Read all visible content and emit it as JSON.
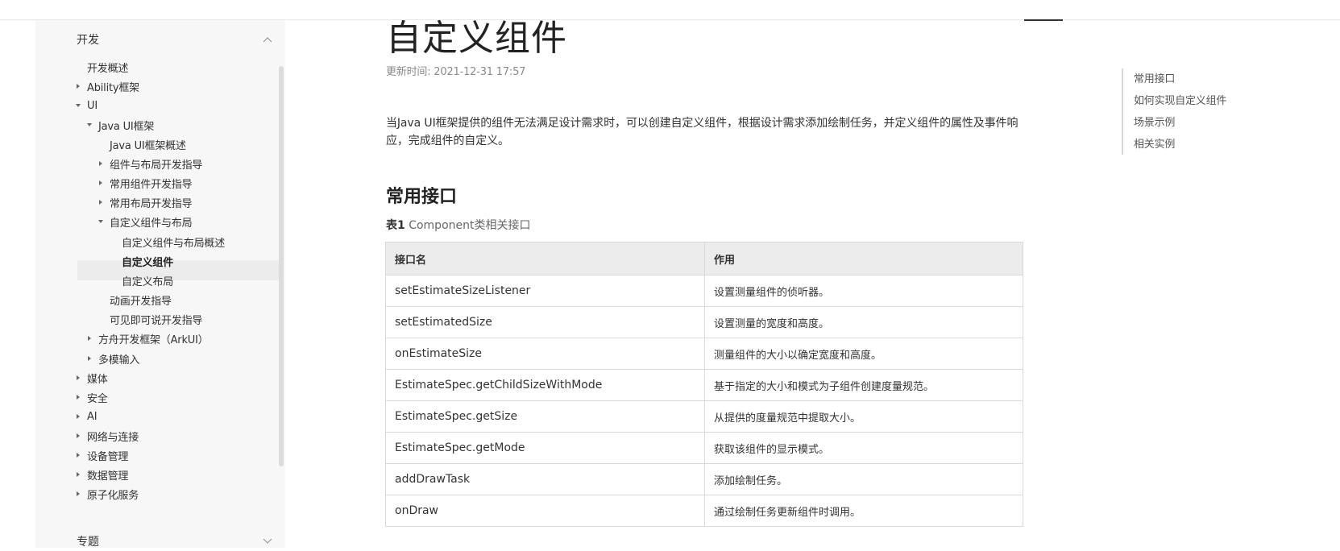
{
  "sidebar": {
    "section_dev": "开发",
    "section_topics": "专题",
    "items": [
      {
        "label": "开发概述"
      },
      {
        "label": "Ability框架"
      },
      {
        "label": "UI"
      },
      {
        "label": "Java UI框架"
      },
      {
        "label": "Java UI框架概述"
      },
      {
        "label": "组件与布局开发指导"
      },
      {
        "label": "常用组件开发指导"
      },
      {
        "label": "常用布局开发指导"
      },
      {
        "label": "自定义组件与布局"
      },
      {
        "label": "自定义组件与布局概述"
      },
      {
        "label": "自定义组件"
      },
      {
        "label": "自定义布局"
      },
      {
        "label": "动画开发指导"
      },
      {
        "label": "可见即可说开发指导"
      },
      {
        "label": "方舟开发框架（ArkUI）"
      },
      {
        "label": "多模输入"
      },
      {
        "label": "媒体"
      },
      {
        "label": "安全"
      },
      {
        "label": "AI"
      },
      {
        "label": "网络与连接"
      },
      {
        "label": "设备管理"
      },
      {
        "label": "数据管理"
      },
      {
        "label": "原子化服务"
      }
    ]
  },
  "main": {
    "title": "自定义组件",
    "updated": "更新时间: 2021-12-31 17:57",
    "intro": "当Java UI框架提供的组件无法满足设计需求时，可以创建自定义组件，根据设计需求添加绘制任务，并定义组件的属性及事件响应，完成组件的自定义。",
    "section_title": "常用接口",
    "table_caption_prefix": "表1",
    "table_caption": "Component类相关接口",
    "table_headers": [
      "接口名",
      "作用"
    ],
    "table_rows": [
      [
        "setEstimateSizeListener",
        "设置测量组件的侦听器。"
      ],
      [
        "setEstimatedSize",
        "设置测量的宽度和高度。"
      ],
      [
        "onEstimateSize",
        "测量组件的大小以确定宽度和高度。"
      ],
      [
        "EstimateSpec.getChildSizeWithMode",
        "基于指定的大小和模式为子组件创建度量规范。"
      ],
      [
        "EstimateSpec.getSize",
        "从提供的度量规范中提取大小。"
      ],
      [
        "EstimateSpec.getMode",
        "获取该组件的显示模式。"
      ],
      [
        "addDrawTask",
        "添加绘制任务。"
      ],
      [
        "onDraw",
        "通过绘制任务更新组件时调用。"
      ]
    ]
  },
  "toc": {
    "items": [
      "常用接口",
      "如何实现自定义组件",
      "场景示例",
      "相关实例"
    ]
  }
}
